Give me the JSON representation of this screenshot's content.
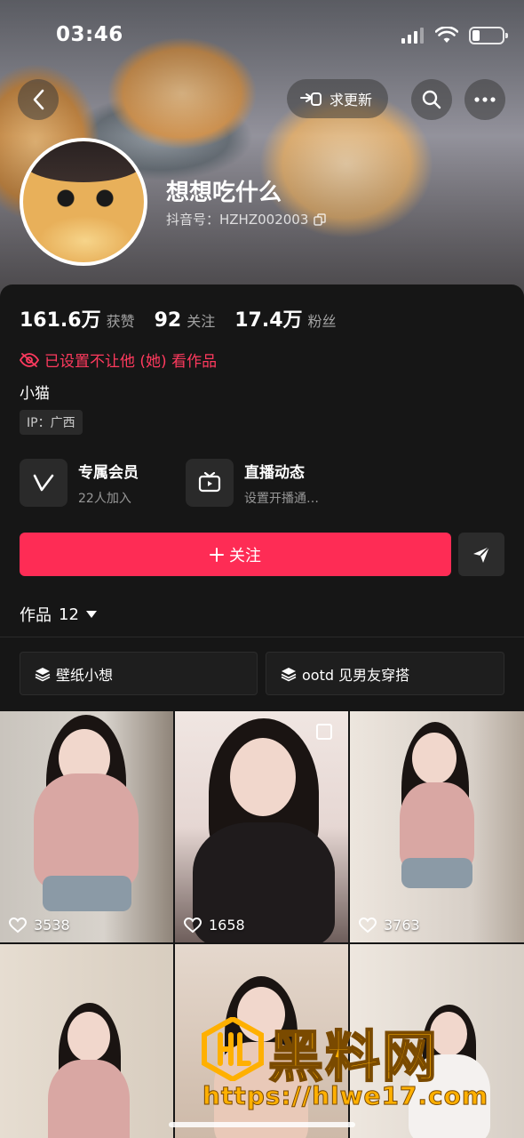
{
  "status_bar": {
    "time": "03:46"
  },
  "header": {
    "update_label": "求更新"
  },
  "profile": {
    "name": "想想吃什么",
    "id_text": "抖音号：HZHZ002003"
  },
  "stats": [
    {
      "value": "161.6万",
      "label": "获赞"
    },
    {
      "value": "92",
      "label": "关注"
    },
    {
      "value": "17.4万",
      "label": "粉丝"
    }
  ],
  "privacy_notice": "已设置不让他 (她) 看作品",
  "bio": "小猫",
  "ip_tag": "IP：广西",
  "features": [
    {
      "title": "专属会员",
      "subtitle": "22人加入"
    },
    {
      "title": "直播动态",
      "subtitle": "设置开播通…"
    }
  ],
  "follow_label": "关注",
  "works_tab": {
    "label": "作品",
    "count": "12"
  },
  "collections": [
    {
      "label": "壁纸小想"
    },
    {
      "label": "ootd 见男友穿搭"
    }
  ],
  "grid": {
    "items": [
      {
        "likes": "3538"
      },
      {
        "likes": "1658"
      },
      {
        "likes": "3763"
      },
      {
        "likes": ""
      },
      {
        "likes": ""
      },
      {
        "likes": ""
      }
    ]
  },
  "watermark": {
    "title": "黑料网",
    "url": "https://hlwe17.com"
  },
  "colors": {
    "accent": "#fe2c55",
    "privacy_red": "#ff3a5e",
    "background": "#161616",
    "watermark": "#ffb000"
  }
}
